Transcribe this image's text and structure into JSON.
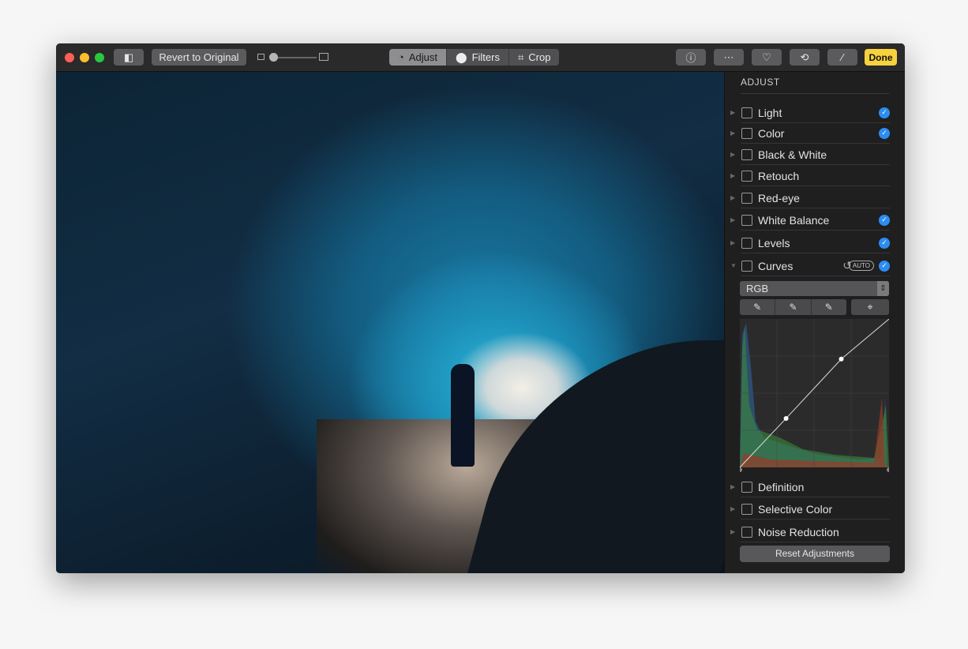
{
  "toolbar": {
    "revert_label": "Revert to Original",
    "tabs": [
      {
        "label": "Adjust",
        "active": true
      },
      {
        "label": "Filters",
        "active": false
      },
      {
        "label": "Crop",
        "active": false
      }
    ],
    "done_label": "Done"
  },
  "sidebar": {
    "title": "ADJUST",
    "items": [
      {
        "label": "Light",
        "icon": "sun-icon",
        "checked": true
      },
      {
        "label": "Color",
        "icon": "color-wheel-icon",
        "checked": true
      },
      {
        "label": "Black & White",
        "icon": "half-circle-icon",
        "checked": false
      },
      {
        "label": "Retouch",
        "icon": "bandage-icon",
        "checked": false
      },
      {
        "label": "Red-eye",
        "icon": "eye-icon",
        "checked": false
      },
      {
        "label": "White Balance",
        "icon": "white-balance-icon",
        "checked": true
      },
      {
        "label": "Levels",
        "icon": "levels-icon",
        "checked": true
      },
      {
        "label": "Curves",
        "icon": "curves-icon",
        "checked": true,
        "expanded": true
      }
    ],
    "curves": {
      "auto_label": "AUTO",
      "channel": "RGB",
      "points": [
        [
          0,
          0
        ],
        [
          0.31,
          0.33
        ],
        [
          0.68,
          0.73
        ],
        [
          1,
          1
        ]
      ]
    },
    "more_items": [
      {
        "label": "Definition",
        "icon": "definition-icon"
      },
      {
        "label": "Selective Color",
        "icon": "selective-color-icon"
      },
      {
        "label": "Noise Reduction",
        "icon": "noise-icon"
      }
    ],
    "reset_label": "Reset Adjustments"
  },
  "colors": {
    "accent": "#2d8cf0",
    "done": "#f7d23e"
  }
}
